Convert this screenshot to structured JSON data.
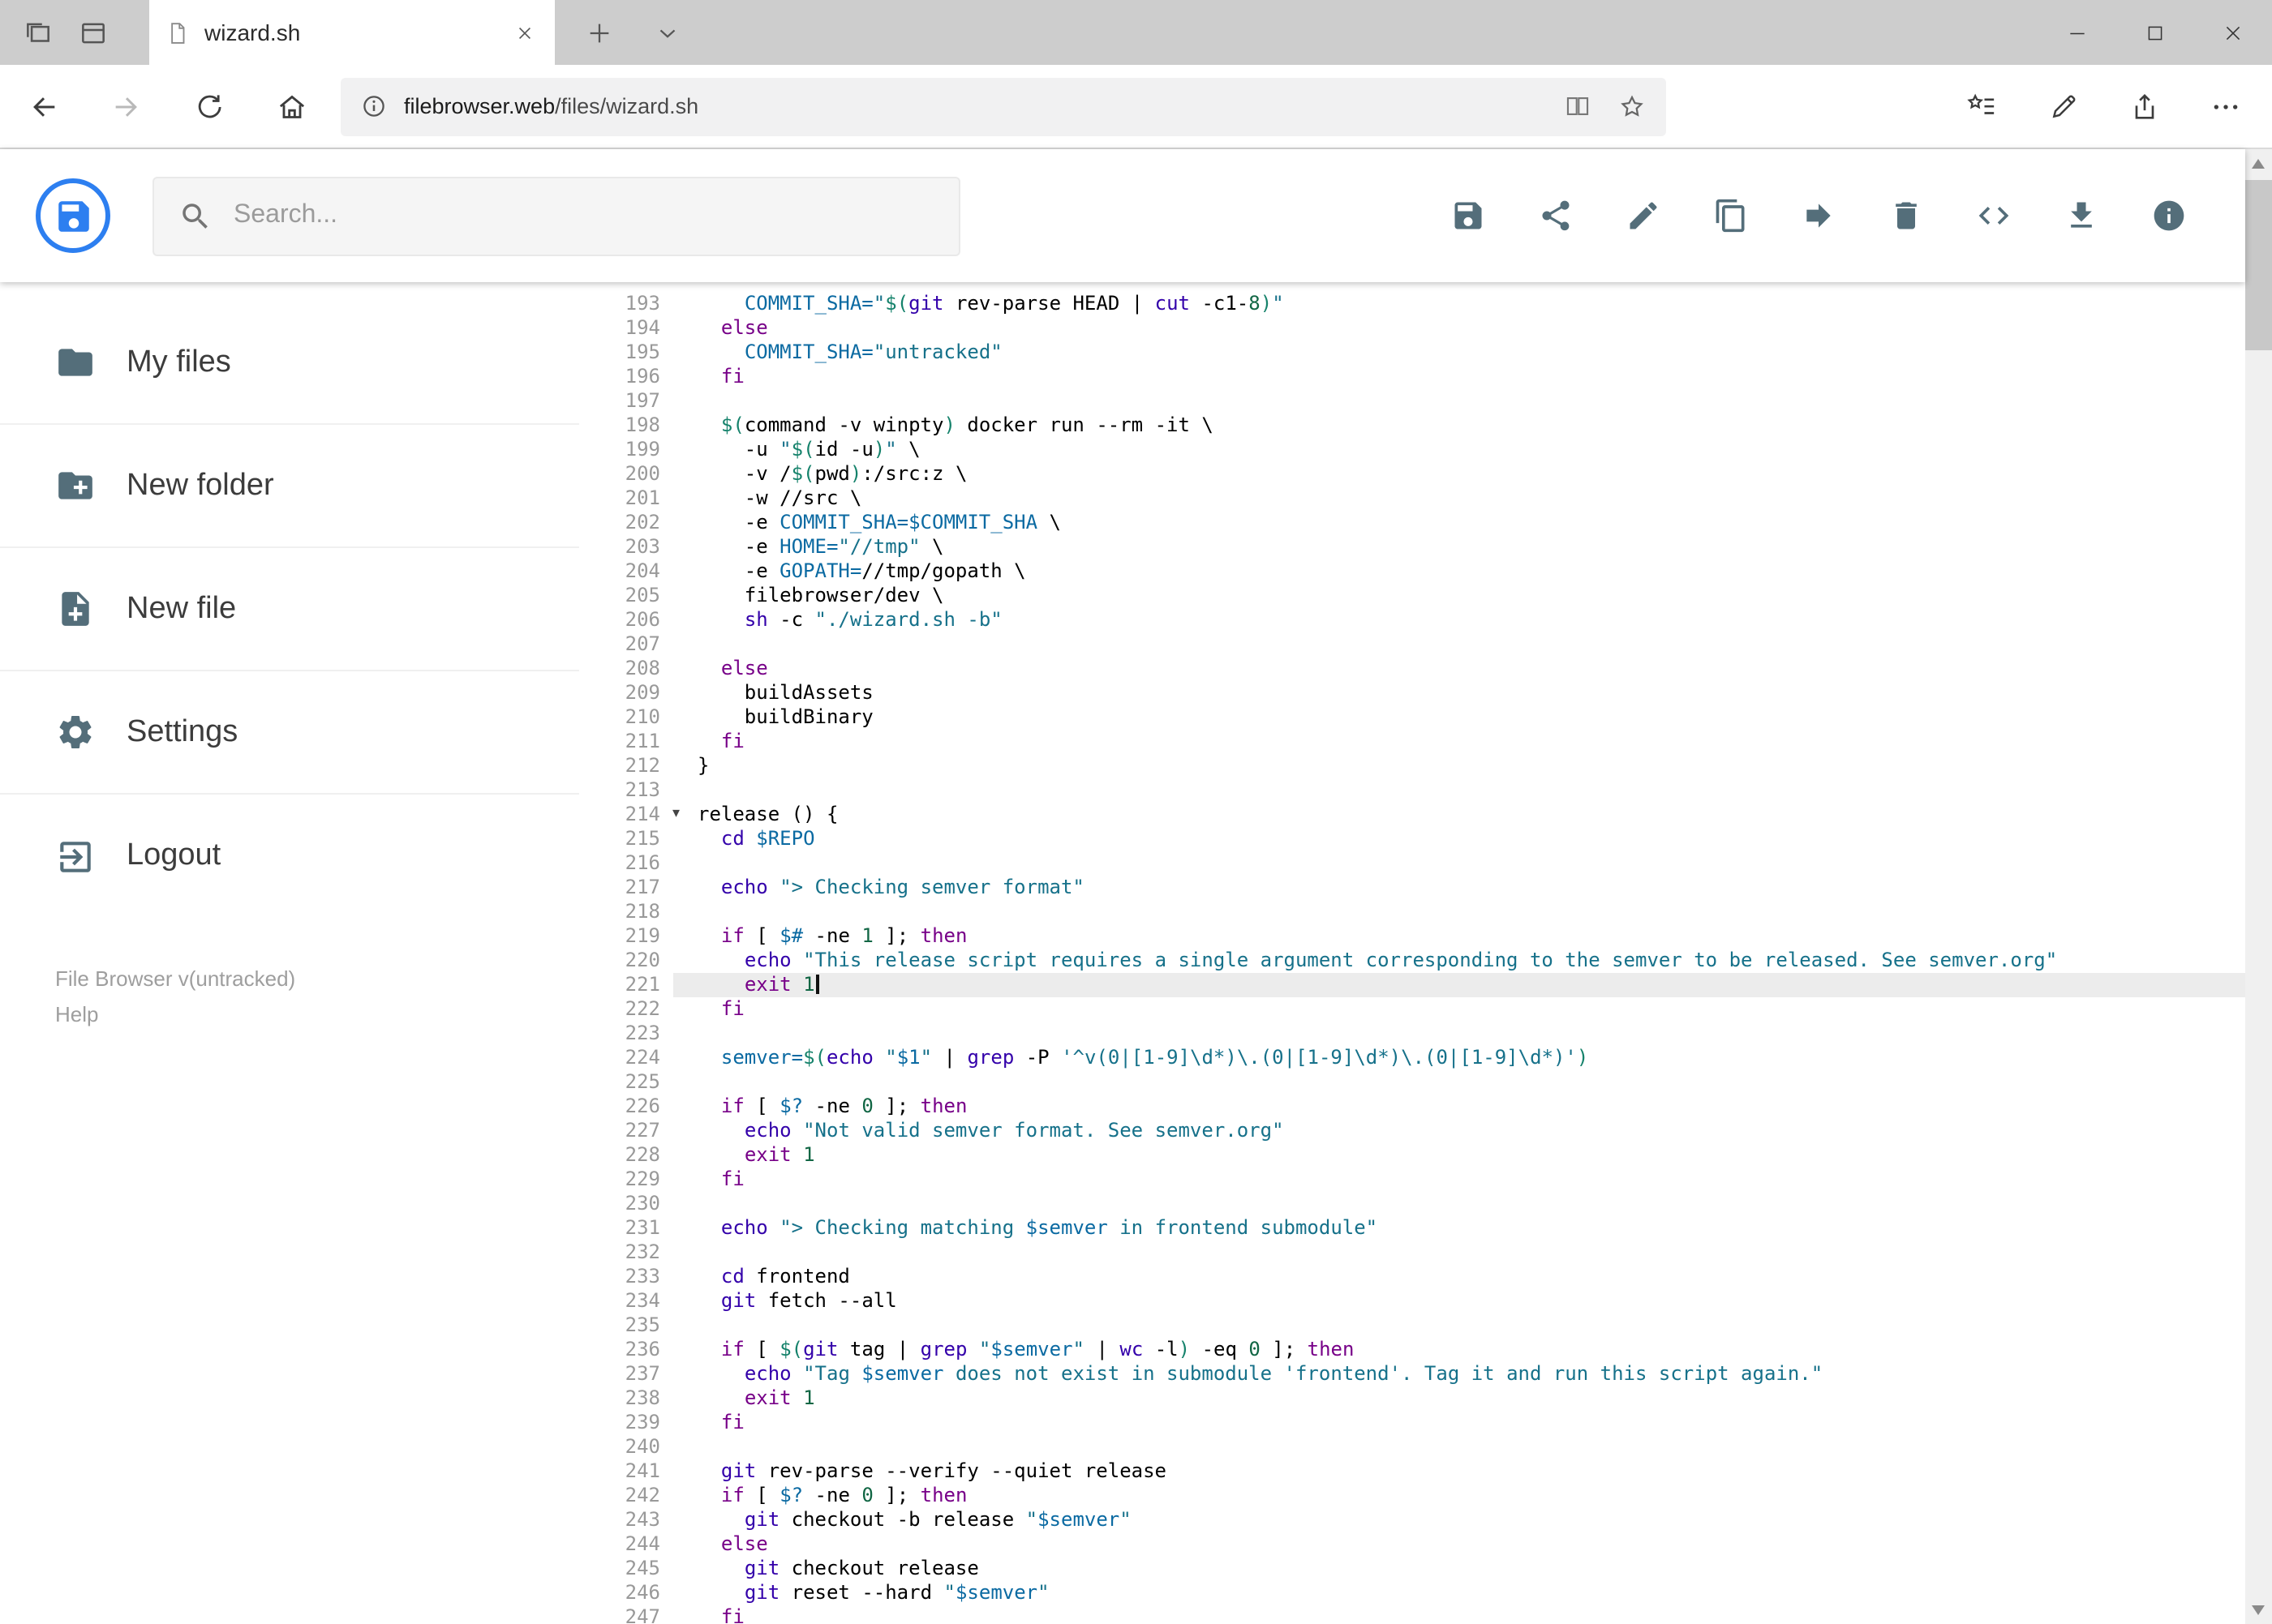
{
  "browser": {
    "tab_title": "wizard.sh",
    "url": {
      "domain": "filebrowser.web",
      "path": "/files/wizard.sh"
    },
    "toolbar_icons": [
      "set-tabs-aside",
      "tab-preview",
      "new-tab",
      "tab-list-chevron",
      "back",
      "forward",
      "refresh",
      "home",
      "page-info",
      "reading-view",
      "favorite-star",
      "hub",
      "web-note",
      "share",
      "more"
    ],
    "window_controls": [
      "minimize",
      "maximize",
      "close"
    ]
  },
  "header": {
    "search_placeholder": "Search...",
    "actions": [
      {
        "icon": "save"
      },
      {
        "icon": "share"
      },
      {
        "icon": "edit"
      },
      {
        "icon": "copy"
      },
      {
        "icon": "move"
      },
      {
        "icon": "delete"
      },
      {
        "icon": "code"
      },
      {
        "icon": "download"
      },
      {
        "icon": "info"
      }
    ]
  },
  "sidebar": {
    "items": [
      {
        "icon": "folder",
        "label": "My files"
      },
      {
        "icon": "new-folder",
        "label": "New folder"
      },
      {
        "icon": "new-file",
        "label": "New file"
      },
      {
        "icon": "settings",
        "label": "Settings"
      },
      {
        "icon": "logout",
        "label": "Logout"
      }
    ],
    "version": "File Browser v(untracked)",
    "help": "Help"
  },
  "colors": {
    "brand_blue": "#2d7ff0",
    "header_icon": "#546e7a",
    "tabbar_bg": "#cdcdcd"
  },
  "editor": {
    "first_line": 193,
    "last_line": 247,
    "active_line": 221,
    "fold_marker_line": 214,
    "fold_marker_glyph": "▾",
    "colors": {
      "plain": "#000000",
      "keyword": "#770088",
      "builtin": "#3300aa",
      "string": "#16718a",
      "variable": "#0b6aa2",
      "quote": "#15826b",
      "number": "#116644",
      "line_number": "#999999",
      "active_line_bg": "#ececec"
    },
    "lines": [
      {
        "n": 193,
        "t": [
          [
            "p",
            "    "
          ],
          [
            "v",
            "COMMIT_SHA="
          ],
          [
            "s",
            "\""
          ],
          [
            "q",
            "$("
          ],
          [
            "b",
            "git"
          ],
          [
            "p",
            " rev-parse HEAD | "
          ],
          [
            "b",
            "cut"
          ],
          [
            "p",
            " -c1-"
          ],
          [
            "n",
            "8"
          ],
          [
            "q",
            ")"
          ],
          [
            "s",
            "\""
          ]
        ]
      },
      {
        "n": 194,
        "t": [
          [
            "p",
            "  "
          ],
          [
            "k",
            "else"
          ]
        ]
      },
      {
        "n": 195,
        "t": [
          [
            "p",
            "    "
          ],
          [
            "v",
            "COMMIT_SHA="
          ],
          [
            "s",
            "\"untracked\""
          ]
        ]
      },
      {
        "n": 196,
        "t": [
          [
            "p",
            "  "
          ],
          [
            "k",
            "fi"
          ]
        ]
      },
      {
        "n": 197,
        "t": []
      },
      {
        "n": 198,
        "t": [
          [
            "p",
            "  "
          ],
          [
            "q",
            "$("
          ],
          [
            "p",
            "command -v winpty"
          ],
          [
            "q",
            ")"
          ],
          [
            "p",
            " docker run --rm -it \\"
          ]
        ]
      },
      {
        "n": 199,
        "t": [
          [
            "p",
            "    -u "
          ],
          [
            "s",
            "\""
          ],
          [
            "q",
            "$("
          ],
          [
            "p",
            "id -u"
          ],
          [
            "q",
            ")"
          ],
          [
            "s",
            "\""
          ],
          [
            "p",
            " \\"
          ]
        ]
      },
      {
        "n": 200,
        "t": [
          [
            "p",
            "    -v /"
          ],
          [
            "q",
            "$("
          ],
          [
            "p",
            "pwd"
          ],
          [
            "q",
            ")"
          ],
          [
            "p",
            ":/src:z \\"
          ]
        ]
      },
      {
        "n": 201,
        "t": [
          [
            "p",
            "    -w //src \\"
          ]
        ]
      },
      {
        "n": 202,
        "t": [
          [
            "p",
            "    -e "
          ],
          [
            "v",
            "COMMIT_SHA=$COMMIT_SHA"
          ],
          [
            "p",
            " \\"
          ]
        ]
      },
      {
        "n": 203,
        "t": [
          [
            "p",
            "    -e "
          ],
          [
            "v",
            "HOME="
          ],
          [
            "s",
            "\"//tmp\""
          ],
          [
            "p",
            " \\"
          ]
        ]
      },
      {
        "n": 204,
        "t": [
          [
            "p",
            "    -e "
          ],
          [
            "v",
            "GOPATH="
          ],
          [
            "p",
            "//tmp/gopath \\"
          ]
        ]
      },
      {
        "n": 205,
        "t": [
          [
            "p",
            "    filebrowser/dev \\"
          ]
        ]
      },
      {
        "n": 206,
        "t": [
          [
            "p",
            "    "
          ],
          [
            "b",
            "sh"
          ],
          [
            "p",
            " -c "
          ],
          [
            "s",
            "\"./wizard.sh -b\""
          ]
        ]
      },
      {
        "n": 207,
        "t": []
      },
      {
        "n": 208,
        "t": [
          [
            "p",
            "  "
          ],
          [
            "k",
            "else"
          ]
        ]
      },
      {
        "n": 209,
        "t": [
          [
            "p",
            "    buildAssets"
          ]
        ]
      },
      {
        "n": 210,
        "t": [
          [
            "p",
            "    buildBinary"
          ]
        ]
      },
      {
        "n": 211,
        "t": [
          [
            "p",
            "  "
          ],
          [
            "k",
            "fi"
          ]
        ]
      },
      {
        "n": 212,
        "t": [
          [
            "p",
            "}"
          ]
        ]
      },
      {
        "n": 213,
        "t": []
      },
      {
        "n": 214,
        "t": [
          [
            "p",
            "release () {"
          ]
        ]
      },
      {
        "n": 215,
        "t": [
          [
            "p",
            "  "
          ],
          [
            "b",
            "cd"
          ],
          [
            "p",
            " "
          ],
          [
            "v",
            "$REPO"
          ]
        ]
      },
      {
        "n": 216,
        "t": []
      },
      {
        "n": 217,
        "t": [
          [
            "p",
            "  "
          ],
          [
            "b",
            "echo"
          ],
          [
            "p",
            " "
          ],
          [
            "s",
            "\"> Checking semver format\""
          ]
        ]
      },
      {
        "n": 218,
        "t": []
      },
      {
        "n": 219,
        "t": [
          [
            "p",
            "  "
          ],
          [
            "k",
            "if"
          ],
          [
            "p",
            " [ "
          ],
          [
            "v",
            "$#"
          ],
          [
            "p",
            " -ne "
          ],
          [
            "n",
            "1"
          ],
          [
            "p",
            " ]; "
          ],
          [
            "k",
            "then"
          ]
        ]
      },
      {
        "n": 220,
        "t": [
          [
            "p",
            "    "
          ],
          [
            "b",
            "echo"
          ],
          [
            "p",
            " "
          ],
          [
            "s",
            "\"This release script requires a single argument corresponding to the semver to be released. See semver.org\""
          ]
        ]
      },
      {
        "n": 221,
        "t": [
          [
            "p",
            "    "
          ],
          [
            "k",
            "exit"
          ],
          [
            "p",
            " "
          ],
          [
            "n",
            "1"
          ]
        ]
      },
      {
        "n": 222,
        "t": [
          [
            "p",
            "  "
          ],
          [
            "k",
            "fi"
          ]
        ]
      },
      {
        "n": 223,
        "t": []
      },
      {
        "n": 224,
        "t": [
          [
            "p",
            "  "
          ],
          [
            "v",
            "semver="
          ],
          [
            "q",
            "$("
          ],
          [
            "b",
            "echo"
          ],
          [
            "p",
            " "
          ],
          [
            "s",
            "\""
          ],
          [
            "v",
            "$1"
          ],
          [
            "s",
            "\""
          ],
          [
            "p",
            " | "
          ],
          [
            "b",
            "grep"
          ],
          [
            "p",
            " -P "
          ],
          [
            "s",
            "'^v(0|[1-9]\\d*)\\.(0|[1-9]\\d*)\\.(0|[1-9]\\d*)'"
          ],
          [
            "q",
            ")"
          ]
        ]
      },
      {
        "n": 225,
        "t": []
      },
      {
        "n": 226,
        "t": [
          [
            "p",
            "  "
          ],
          [
            "k",
            "if"
          ],
          [
            "p",
            " [ "
          ],
          [
            "v",
            "$?"
          ],
          [
            "p",
            " -ne "
          ],
          [
            "n",
            "0"
          ],
          [
            "p",
            " ]; "
          ],
          [
            "k",
            "then"
          ]
        ]
      },
      {
        "n": 227,
        "t": [
          [
            "p",
            "    "
          ],
          [
            "b",
            "echo"
          ],
          [
            "p",
            " "
          ],
          [
            "s",
            "\"Not valid semver format. See semver.org\""
          ]
        ]
      },
      {
        "n": 228,
        "t": [
          [
            "p",
            "    "
          ],
          [
            "k",
            "exit"
          ],
          [
            "p",
            " "
          ],
          [
            "n",
            "1"
          ]
        ]
      },
      {
        "n": 229,
        "t": [
          [
            "p",
            "  "
          ],
          [
            "k",
            "fi"
          ]
        ]
      },
      {
        "n": 230,
        "t": []
      },
      {
        "n": 231,
        "t": [
          [
            "p",
            "  "
          ],
          [
            "b",
            "echo"
          ],
          [
            "p",
            " "
          ],
          [
            "s",
            "\"> Checking matching "
          ],
          [
            "v",
            "$semver"
          ],
          [
            "s",
            " in frontend submodule\""
          ]
        ]
      },
      {
        "n": 232,
        "t": []
      },
      {
        "n": 233,
        "t": [
          [
            "p",
            "  "
          ],
          [
            "b",
            "cd"
          ],
          [
            "p",
            " frontend"
          ]
        ]
      },
      {
        "n": 234,
        "t": [
          [
            "p",
            "  "
          ],
          [
            "b",
            "git"
          ],
          [
            "p",
            " fetch --all"
          ]
        ]
      },
      {
        "n": 235,
        "t": []
      },
      {
        "n": 236,
        "t": [
          [
            "p",
            "  "
          ],
          [
            "k",
            "if"
          ],
          [
            "p",
            " [ "
          ],
          [
            "q",
            "$("
          ],
          [
            "b",
            "git"
          ],
          [
            "p",
            " tag | "
          ],
          [
            "b",
            "grep"
          ],
          [
            "p",
            " "
          ],
          [
            "s",
            "\""
          ],
          [
            "v",
            "$semver"
          ],
          [
            "s",
            "\""
          ],
          [
            "p",
            " | "
          ],
          [
            "b",
            "wc"
          ],
          [
            "p",
            " -l"
          ],
          [
            "q",
            ")"
          ],
          [
            "p",
            " -eq "
          ],
          [
            "n",
            "0"
          ],
          [
            "p",
            " ]; "
          ],
          [
            "k",
            "then"
          ]
        ]
      },
      {
        "n": 237,
        "t": [
          [
            "p",
            "    "
          ],
          [
            "b",
            "echo"
          ],
          [
            "p",
            " "
          ],
          [
            "s",
            "\"Tag "
          ],
          [
            "v",
            "$semver"
          ],
          [
            "s",
            " does not exist in submodule 'frontend'. Tag it and run this script again.\""
          ]
        ]
      },
      {
        "n": 238,
        "t": [
          [
            "p",
            "    "
          ],
          [
            "k",
            "exit"
          ],
          [
            "p",
            " "
          ],
          [
            "n",
            "1"
          ]
        ]
      },
      {
        "n": 239,
        "t": [
          [
            "p",
            "  "
          ],
          [
            "k",
            "fi"
          ]
        ]
      },
      {
        "n": 240,
        "t": []
      },
      {
        "n": 241,
        "t": [
          [
            "p",
            "  "
          ],
          [
            "b",
            "git"
          ],
          [
            "p",
            " rev-parse --verify --quiet release"
          ]
        ]
      },
      {
        "n": 242,
        "t": [
          [
            "p",
            "  "
          ],
          [
            "k",
            "if"
          ],
          [
            "p",
            " [ "
          ],
          [
            "v",
            "$?"
          ],
          [
            "p",
            " -ne "
          ],
          [
            "n",
            "0"
          ],
          [
            "p",
            " ]; "
          ],
          [
            "k",
            "then"
          ]
        ]
      },
      {
        "n": 243,
        "t": [
          [
            "p",
            "    "
          ],
          [
            "b",
            "git"
          ],
          [
            "p",
            " checkout -b release "
          ],
          [
            "s",
            "\""
          ],
          [
            "v",
            "$semver"
          ],
          [
            "s",
            "\""
          ]
        ]
      },
      {
        "n": 244,
        "t": [
          [
            "p",
            "  "
          ],
          [
            "k",
            "else"
          ]
        ]
      },
      {
        "n": 245,
        "t": [
          [
            "p",
            "    "
          ],
          [
            "b",
            "git"
          ],
          [
            "p",
            " checkout release"
          ]
        ]
      },
      {
        "n": 246,
        "t": [
          [
            "p",
            "    "
          ],
          [
            "b",
            "git"
          ],
          [
            "p",
            " reset --hard "
          ],
          [
            "s",
            "\""
          ],
          [
            "v",
            "$semver"
          ],
          [
            "s",
            "\""
          ]
        ]
      },
      {
        "n": 247,
        "t": [
          [
            "p",
            "  "
          ],
          [
            "k",
            "fi"
          ]
        ]
      }
    ]
  }
}
